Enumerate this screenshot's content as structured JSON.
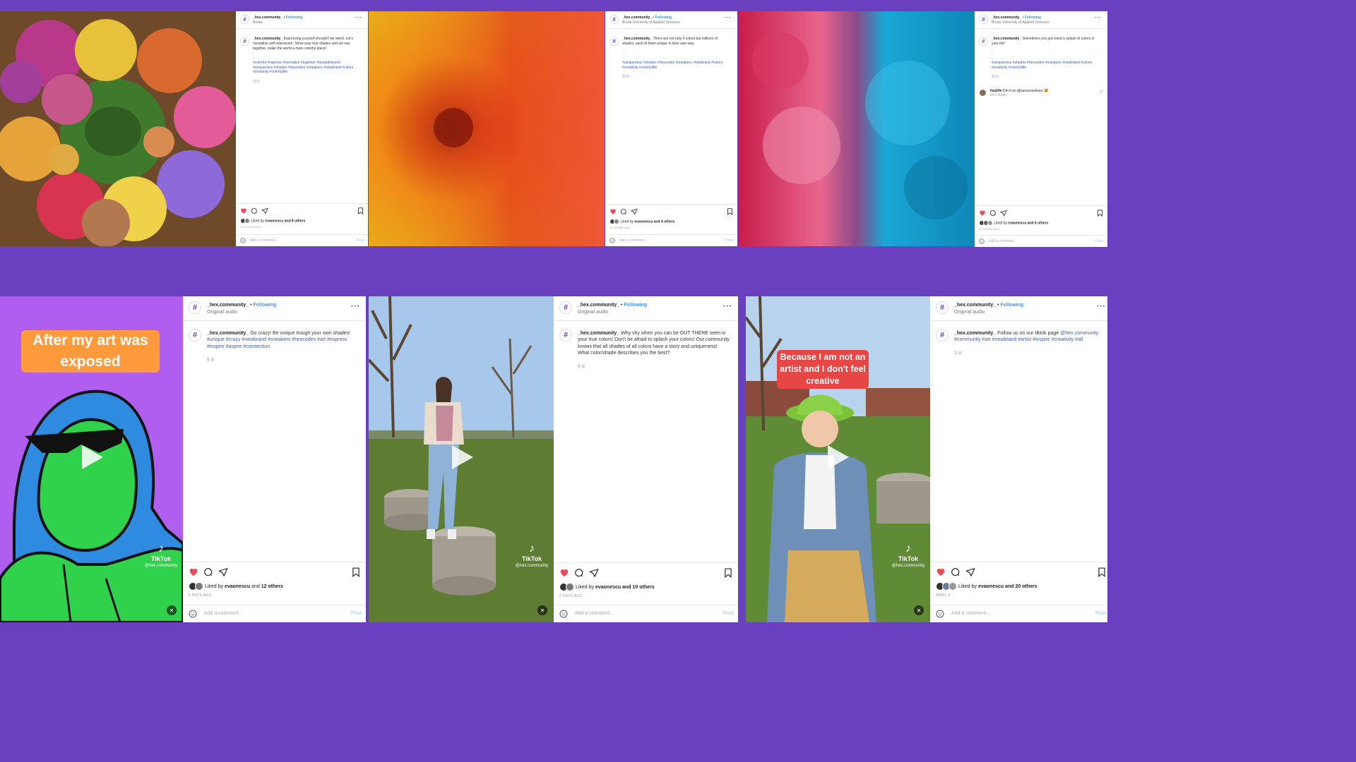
{
  "brand": {
    "name": "_hex.community_",
    "follow": "Following",
    "logo_glyph": "#",
    "colors": {
      "background": "#6a3fc0",
      "link": "#3897f0",
      "heart": "#ed4956"
    }
  },
  "posts": [
    {
      "location": "Breda",
      "caption": "Expressing yourself shouldn't be weird. Let's normalize self expression. Show your true shades and we can, together, make the world a more colorful place!",
      "tags": "#colorful #express #normalize #togheter #beautifulworld #uniqueness #shades #hexcodes #sneakers #newbrand #colors #creativity #colorfullife",
      "time": "10 h",
      "liked_by": "evaonescu",
      "others": "and 8 others",
      "ago": "10 HOURS AGO",
      "add_comment": "Add a comment...",
      "post": "Post"
    },
    {
      "location": "Breda University of Applied Sciences",
      "caption": "There are not only 4 colors but millions of shades, each of them unique in their own way.",
      "tags": "#uniqueness #shades #hexcodes #sneakers #newbrand #colors #creativity #colorfullife",
      "time": "10 h",
      "liked_by": "evaonescu",
      "others": "and 4 others",
      "ago": "10 HOURS AGO",
      "add_comment": "Add a comment...",
      "post": "Post"
    },
    {
      "location": "Breda University of Applied Sciences",
      "caption": "Sometimes you just need a splash of colors in your life!",
      "tags": "#uniqueness #shades #hexcodes #sneakers #newbrand #colors #creativity #colorfullife",
      "time": "10 h",
      "comment_user": "liza24n",
      "comment_text": "Dm it on @successshoes 🤩",
      "comment_time": "10 h",
      "comment_reply": "Reply",
      "liked_by": "evaonescu",
      "others": "and 6 others",
      "ago": "10 HOURS AGO",
      "add_comment": "Add a comment...",
      "post": "Post"
    },
    {
      "location": "Original audio",
      "caption": "Go crazy! Be unique trough your own shades!",
      "tags": "#unique #crazy #newbrand #sneakers #hexcodes #art #express #inspire #aspire #connection",
      "time": "5 d",
      "liked_by": "evaonescu",
      "others": "and 12 others",
      "ago": "5 DAYS AGO",
      "add_comment": "Add a comment...",
      "post": "Post",
      "overlay": "After my art was exposed",
      "tiktok": "TikTok",
      "handle": "@hex.community"
    },
    {
      "location": "Original audio",
      "caption": "Why shy when you can be OUT THERE seen in your true colors! Don't be afraid to splash your colors! Our community knows that all shades of all colors have a story and uniqueness! What color/shade describes you the best?",
      "tags": "",
      "time": "6 d",
      "liked_by": "evaonescu",
      "others": "and 10 others",
      "ago": "6 DAYS AGO",
      "add_comment": "Add a comment...",
      "post": "Post",
      "tiktok": "TikTok",
      "handle": "@hex.community"
    },
    {
      "location": "Original audio",
      "caption": "Follow us on our tiktok page",
      "caption_link": "@hex.community",
      "tags": "#community #art #newbrand #artist #inspire #creativity #all",
      "time": "1 w",
      "liked_by": "evaonescu",
      "others": "and 20 others",
      "ago": "APRIL 8",
      "add_comment": "Add a comment...",
      "post": "Post",
      "overlay": "Because I am not an artist and I don't feel creative",
      "tiktok": "TikTok",
      "handle": "@hex.community"
    }
  ]
}
